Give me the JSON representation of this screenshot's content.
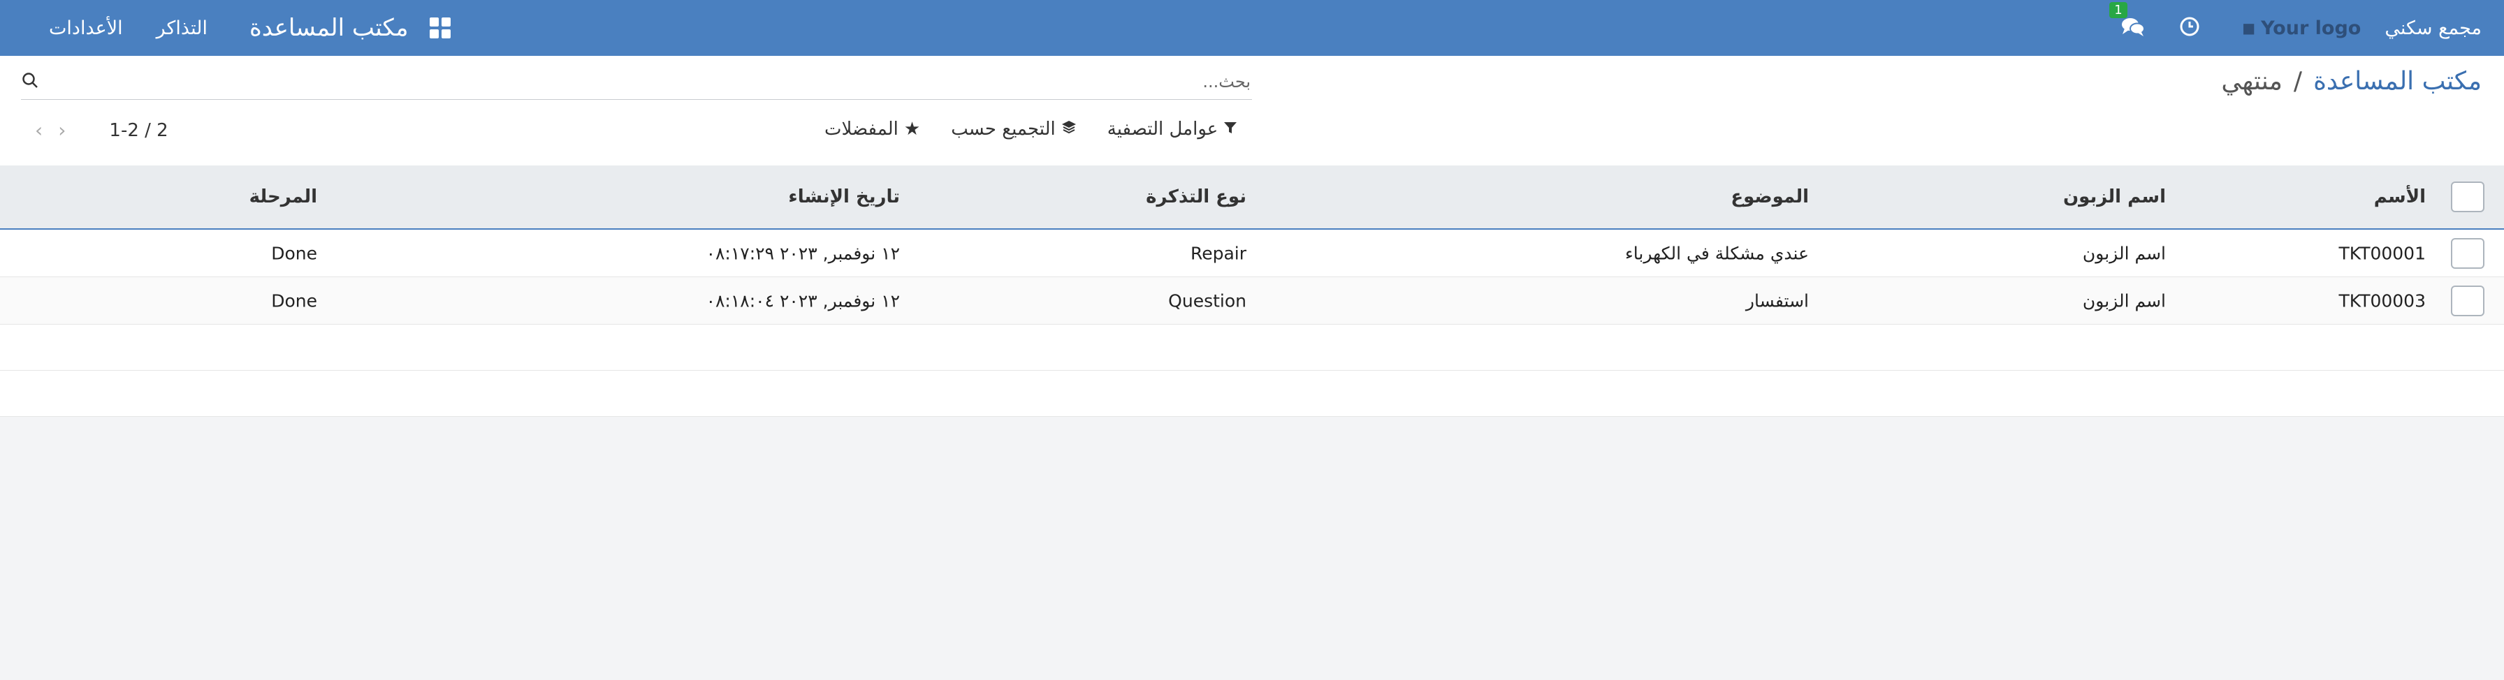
{
  "navbar": {
    "app_name": "مكتب المساعدة",
    "menu": [
      "التذاكر",
      "الأعدادات"
    ],
    "company": "مجمع سكني",
    "logo_text": "Your logo",
    "chat_badge": "1",
    "bg_color": "#4a80c0"
  },
  "breadcrumb": {
    "parent": "مكتب المساعدة",
    "separator": "/",
    "current": "منتهي"
  },
  "search": {
    "placeholder": "بحث...",
    "value": ""
  },
  "filters": {
    "filter_label": "عوامل التصفية",
    "groupby_label": "التجميع حسب",
    "favorites_label": "المفضلات"
  },
  "pager": {
    "value": "1-2 / 2"
  },
  "table": {
    "headers": {
      "name": "الأسم",
      "customer": "اسم الزبون",
      "subject": "الموضوع",
      "ticket_type": "نوع التذكرة",
      "created": "تاريخ الإنشاء",
      "stage": "المرحلة"
    },
    "rows": [
      {
        "name": "TKT00001",
        "customer": "اسم الزبون",
        "subject": "عندي مشكلة في الكهرباء",
        "ticket_type": "Repair",
        "created": "١٢ نوفمبر, ٢٠٢٣ ٠٨:١٧:٢٩",
        "stage": "Done"
      },
      {
        "name": "TKT00003",
        "customer": "اسم الزبون",
        "subject": "استفسار",
        "ticket_type": "Question",
        "created": "١٢ نوفمبر, ٢٠٢٣ ٠٨:١٨:٠٤",
        "stage": "Done"
      }
    ]
  }
}
